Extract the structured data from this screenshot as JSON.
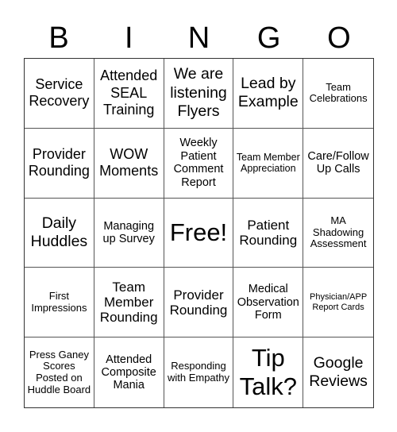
{
  "header": {
    "letters": [
      "B",
      "I",
      "N",
      "G",
      "O"
    ]
  },
  "board": {
    "rows": [
      [
        "Service Recovery",
        "Attended SEAL Training",
        "We are listening Flyers",
        "Lead by Example",
        "Team Celebrations"
      ],
      [
        "Provider Rounding",
        "WOW Moments",
        "Weekly Patient Comment Report",
        "Team Member Appreciation",
        "Care/Follow Up Calls"
      ],
      [
        "Daily Huddles",
        "Managing up Survey",
        "Free!",
        "Patient Rounding",
        "MA Shadowing Assessment"
      ],
      [
        "First Impressions",
        "Team Member Rounding",
        "Provider Rounding",
        "Medical Observation Form",
        "Physician/APP Report Cards"
      ],
      [
        "Press Ganey Scores Posted on Huddle Board",
        "Attended Composite Mania",
        "Responding with Empathy",
        "Tip Talk?",
        "Google Reviews"
      ]
    ]
  }
}
